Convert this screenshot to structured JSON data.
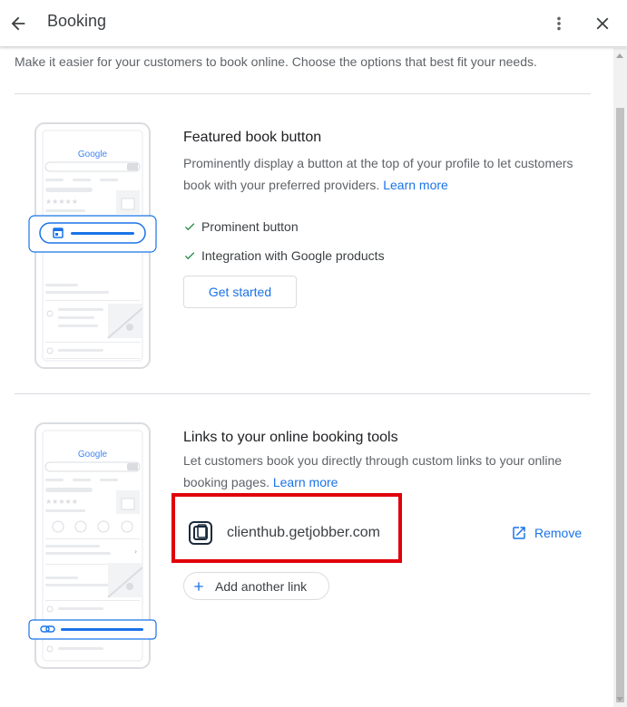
{
  "header": {
    "title": "Booking",
    "back_icon": "arrow-back-icon",
    "more_icon": "more-vert-icon",
    "close_icon": "close-icon"
  },
  "intro": "Make it easier for your customers to book online. Choose the options that best fit your needs.",
  "featured": {
    "title": "Featured book button",
    "desc": "Prominently display a button at the top of your profile to let customers book with your preferred providers.",
    "learn_more": "Learn more",
    "features": [
      "Prominent button",
      "Integration with Google products"
    ],
    "cta": "Get started"
  },
  "links": {
    "title": "Links to your online booking tools",
    "desc": "Let customers book you directly through custom links to your online booking pages.",
    "learn_more": "Learn more",
    "booking_url": "clienthub.getjobber.com",
    "remove": "Remove",
    "add_another": "Add another link"
  },
  "illustration": {
    "google_text": "Google"
  },
  "colors": {
    "accent": "#1a73e8",
    "check": "#188038",
    "highlight": "#e0000b"
  }
}
